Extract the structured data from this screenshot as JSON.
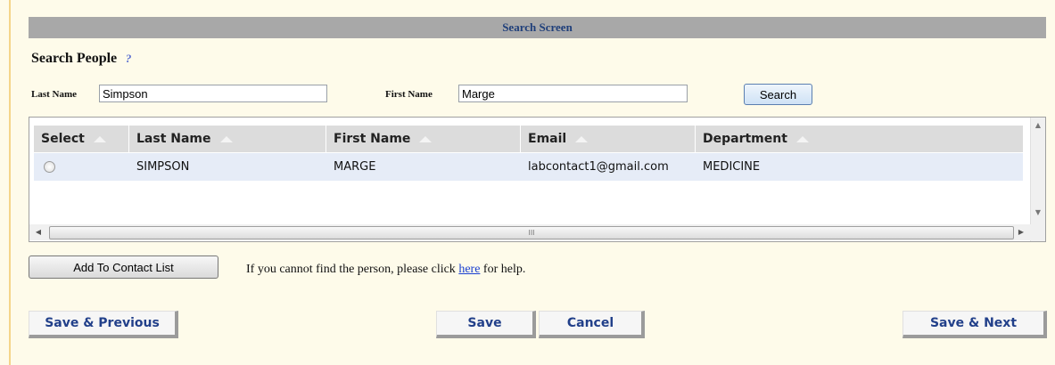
{
  "title_bar": {
    "text": "Search Screen"
  },
  "section": {
    "title": "Search People",
    "help_icon": "help-question-icon"
  },
  "search_form": {
    "last_name_label": "Last Name",
    "last_name_value": "Simpson",
    "first_name_label": "First Name",
    "first_name_value": "Marge",
    "search_button": "Search"
  },
  "grid": {
    "columns": [
      "Select",
      "Last Name",
      "First Name",
      "Email",
      "Department"
    ],
    "rows": [
      {
        "last_name": "SIMPSON",
        "first_name": "MARGE",
        "email": "labcontact1@gmail.com",
        "department": "MEDICINE"
      }
    ],
    "hscroll_grip": "III"
  },
  "actions": {
    "add_button": "Add To Contact List",
    "help_prefix": "If you cannot find the person, please click ",
    "help_link": "here",
    "help_suffix": " for help."
  },
  "nav": {
    "save_previous": "Save & Previous",
    "save": "Save",
    "cancel": "Cancel",
    "save_next": "Save & Next"
  },
  "colors": {
    "title_bar_bg": "#a8a8a8",
    "title_text": "#1f3f7a",
    "row_highlight": "#e6ecf7",
    "nav_text": "#22408a",
    "link": "#1a3fd0"
  }
}
